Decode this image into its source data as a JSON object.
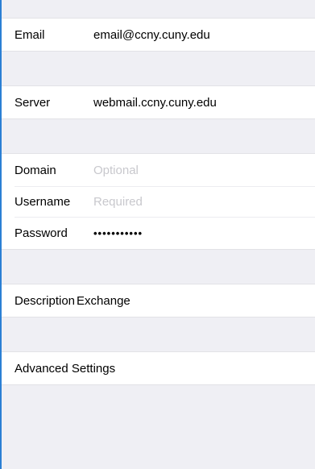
{
  "account_form": {
    "email": {
      "label": "Email",
      "value": "email@ccny.cuny.edu"
    },
    "server": {
      "label": "Server",
      "value": "webmail.ccny.cuny.edu"
    },
    "domain": {
      "label": "Domain",
      "placeholder": "Optional"
    },
    "username": {
      "label": "Username",
      "placeholder": "Required"
    },
    "password": {
      "label": "Password",
      "value": "•••••••••••"
    },
    "description": {
      "label": "Description",
      "value": "Exchange"
    },
    "advanced_settings": {
      "label": "Advanced Settings"
    }
  },
  "colors": {
    "grouped_background": "#efeff4",
    "cell_background": "#ffffff",
    "placeholder_text": "#c8c8cd",
    "left_border_accent": "#2b7fd4"
  }
}
